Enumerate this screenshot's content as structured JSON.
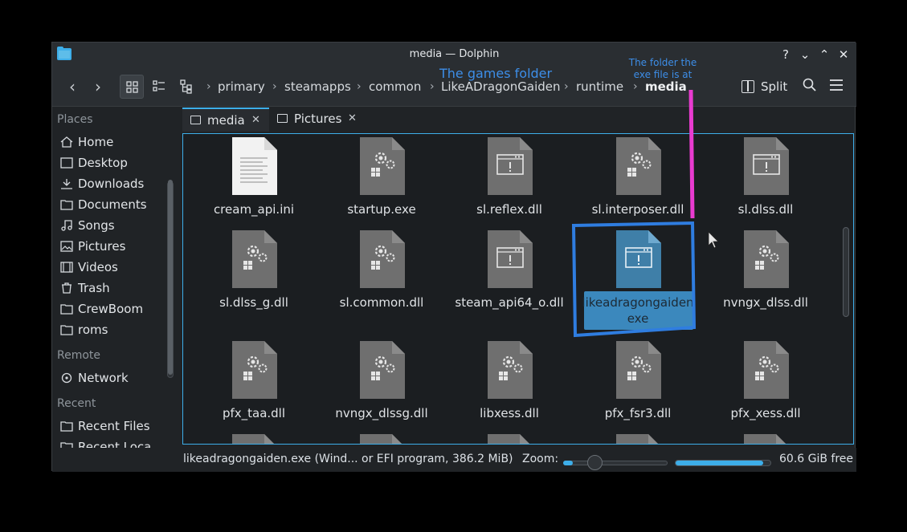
{
  "window": {
    "title": "media — Dolphin"
  },
  "titlebar_buttons": {
    "help": "?",
    "minimize": "⌄",
    "maximize": "⌃",
    "close": "✕"
  },
  "toolbar": {
    "back": "‹",
    "forward": "›",
    "breadcrumb": [
      "primary",
      "steamapps",
      "common",
      "LikeADragonGaiden",
      "runtime",
      "media"
    ],
    "separator": "›",
    "split_label": "Split"
  },
  "sidebar": {
    "places_header": "Places",
    "places": [
      "Home",
      "Desktop",
      "Downloads",
      "Documents",
      "Songs",
      "Pictures",
      "Videos",
      "Trash",
      "CrewBoom",
      "roms"
    ],
    "remote_header": "Remote",
    "remote": [
      "Network"
    ],
    "recent_header": "Recent",
    "recent": [
      "Recent Files",
      "Recent Loca..."
    ]
  },
  "tabs": [
    {
      "label": "media",
      "close": "✕"
    },
    {
      "label": "Pictures",
      "close": "✕"
    }
  ],
  "files": [
    {
      "name": "cream_api.ini",
      "kind": "text"
    },
    {
      "name": "startup.exe",
      "kind": "gear"
    },
    {
      "name": "sl.reflex.dll",
      "kind": "window"
    },
    {
      "name": "sl.interposer.dll",
      "kind": "gear"
    },
    {
      "name": "sl.dlss.dll",
      "kind": "window"
    },
    {
      "name": "sl.dlss_g.dll",
      "kind": "gear"
    },
    {
      "name": "sl.common.dll",
      "kind": "gear"
    },
    {
      "name": "steam_api64_o.dll",
      "kind": "window"
    },
    {
      "name": "likeadragongaiden\nexe",
      "kind": "window-blue",
      "selected": true
    },
    {
      "name": "nvngx_dlss.dll",
      "kind": "gear"
    },
    {
      "name": "pfx_taa.dll",
      "kind": "gear"
    },
    {
      "name": "nvngx_dlssg.dll",
      "kind": "gear"
    },
    {
      "name": "libxess.dll",
      "kind": "gear"
    },
    {
      "name": "pfx_fsr3.dll",
      "kind": "gear"
    },
    {
      "name": "pfx_xess.dll",
      "kind": "gear"
    }
  ],
  "statusbar": {
    "selection": "likeadragongaiden.exe (Wind... or EFI program, 386.2 MiB)",
    "zoom_label": "Zoom:",
    "zoom_level": 0.3,
    "free_space": "60.6 GiB free",
    "used_fraction": 0.92
  },
  "annotations": {
    "games_folder": "The games folder",
    "exe_folder": "The folder the exe file is at"
  },
  "colors": {
    "accent": "#3daee9",
    "annotation_text": "#3d8ee8",
    "annotation_box": "#2f7de0",
    "annotation_line": "#e93bd0"
  }
}
